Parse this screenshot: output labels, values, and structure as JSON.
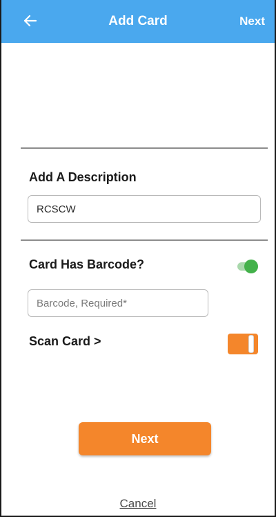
{
  "header": {
    "title": "Add Card",
    "next_label": "Next",
    "back_icon": "arrow-left-icon",
    "background_color": "#4aa8ee"
  },
  "description": {
    "label": "Add A Description",
    "value": "RCSCW"
  },
  "barcode": {
    "label": "Card Has Barcode?",
    "toggle_on": true,
    "toggle_color": "#43b14a",
    "input_placeholder": "Barcode, Required*",
    "input_value": ""
  },
  "scan": {
    "label": "Scan Card >",
    "toggle_on": true,
    "toggle_color": "#f4862b"
  },
  "footer": {
    "next_button_label": "Next",
    "next_button_color": "#f4862b",
    "cancel_label": "Cancel"
  }
}
